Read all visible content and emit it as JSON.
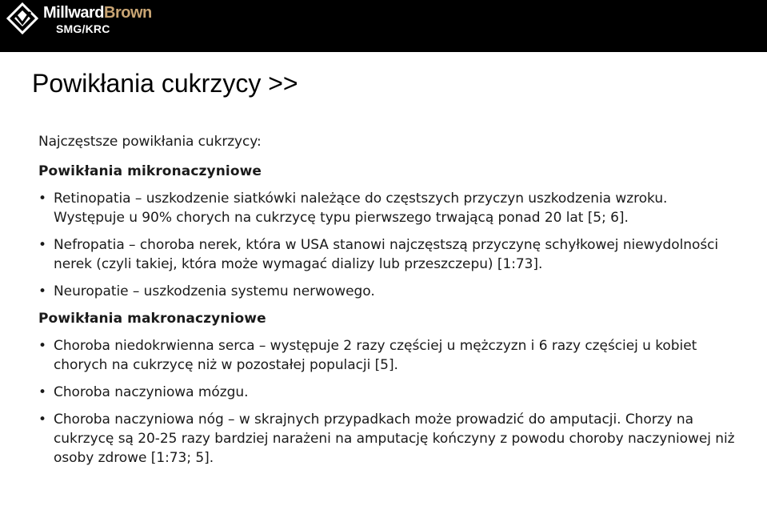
{
  "header": {
    "brand_first": "Millward",
    "brand_second": "Brown",
    "brand_sub": "SMG/KRC",
    "colors": {
      "bar": "#000000",
      "brand_primary": "#ffffff",
      "brand_accent": "#c9a574"
    },
    "logo_icon": "diamond-mark-icon"
  },
  "slide": {
    "title": "Powikłania cukrzycy >>",
    "intro": "Najczęstsze powikłania cukrzycy:",
    "sections": [
      {
        "heading": "Powikłania mikronaczyniowe",
        "items": [
          "Retinopatia – uszkodzenie siatkówki należące do częstszych przyczyn uszkodzenia wzroku. Występuje u 90% chorych na cukrzycę typu pierwszego trwającą ponad 20 lat [5; 6].",
          "Nefropatia – choroba nerek, która w USA stanowi najczęstszą przyczynę schyłkowej niewydolności nerek (czyli takiej, która może wymagać dializy lub przeszczepu) [1:73].",
          "Neuropatie – uszkodzenia systemu nerwowego."
        ]
      },
      {
        "heading": "Powikłania makronaczyniowe",
        "items": [
          "Choroba niedokrwienna serca – występuje 2 razy częściej u mężczyzn i 6 razy częściej u kobiet chorych na cukrzycę niż w pozostałej populacji [5].",
          "Choroba naczyniowa mózgu.",
          "Choroba naczyniowa nóg – w skrajnych przypadkach może prowadzić do amputacji. Chorzy na cukrzycę są 20-25 razy bardziej narażeni na amputację kończyny z powodu choroby naczyniowej niż osoby zdrowe [1:73; 5]."
        ]
      }
    ]
  }
}
